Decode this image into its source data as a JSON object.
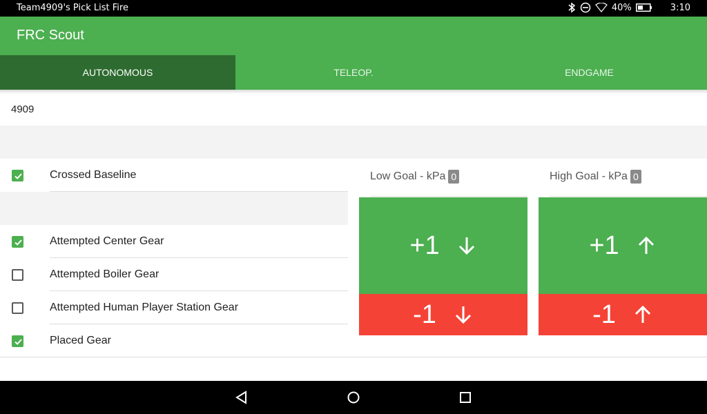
{
  "status_bar": {
    "left_text": "Team4909's Pick List Fire",
    "battery": "40%",
    "time": "3:10"
  },
  "app_bar": {
    "title": "FRC Scout"
  },
  "tabs": [
    {
      "label": "AUTONOMOUS",
      "active": true
    },
    {
      "label": "TELEOP.",
      "active": false
    },
    {
      "label": "ENDGAME",
      "active": false
    }
  ],
  "team_number": "4909",
  "checks": [
    {
      "label": "Crossed Baseline",
      "checked": true
    },
    {
      "label": "Attempted Center Gear",
      "checked": true
    },
    {
      "label": "Attempted Boiler Gear",
      "checked": false
    },
    {
      "label": "Attempted Human Player Station Gear",
      "checked": false
    },
    {
      "label": "Placed Gear",
      "checked": true
    }
  ],
  "low_goal": {
    "label": "Low Goal - kPa",
    "count": "0",
    "plus": "+1",
    "minus": "-1"
  },
  "high_goal": {
    "label": "High Goal - kPa",
    "count": "0",
    "plus": "+1",
    "minus": "-1"
  },
  "colors": {
    "primary": "#4caf50",
    "primary_dark": "#2e6b30",
    "danger": "#f44336"
  }
}
